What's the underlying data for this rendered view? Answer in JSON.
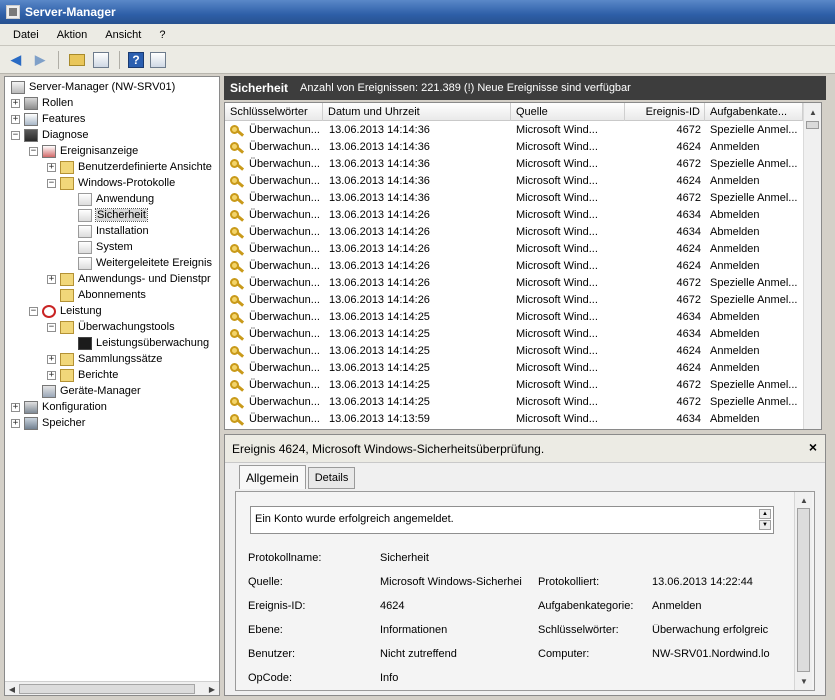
{
  "window": {
    "title": "Server-Manager"
  },
  "menu": [
    "Datei",
    "Aktion",
    "Ansicht",
    "?"
  ],
  "toolbar": {
    "help_label": "?"
  },
  "tree": [
    {
      "label": "Server-Manager (NW-SRV01)",
      "level": 0,
      "exp": "",
      "icon": "server-icon"
    },
    {
      "label": "Rollen",
      "level": 0,
      "exp": "+",
      "icon": "roles-icon"
    },
    {
      "label": "Features",
      "level": 0,
      "exp": "+",
      "icon": "features-icon"
    },
    {
      "label": "Diagnose",
      "level": 0,
      "exp": "-",
      "icon": "diagnostics-icon"
    },
    {
      "label": "Ereignisanzeige",
      "level": 1,
      "exp": "-",
      "icon": "event-viewer-icon"
    },
    {
      "label": "Benutzerdefinierte Ansichte",
      "level": 2,
      "exp": "+",
      "icon": "folder-icon"
    },
    {
      "label": "Windows-Protokolle",
      "level": 2,
      "exp": "-",
      "icon": "folder-icon"
    },
    {
      "label": "Anwendung",
      "level": 3,
      "exp": "",
      "icon": "log-icon"
    },
    {
      "label": "Sicherheit",
      "level": 3,
      "exp": "",
      "icon": "log-icon",
      "selected": true
    },
    {
      "label": "Installation",
      "level": 3,
      "exp": "",
      "icon": "log-icon"
    },
    {
      "label": "System",
      "level": 3,
      "exp": "",
      "icon": "log-icon"
    },
    {
      "label": "Weitergeleitete Ereignis",
      "level": 3,
      "exp": "",
      "icon": "log-icon"
    },
    {
      "label": "Anwendungs- und Dienstpr",
      "level": 2,
      "exp": "+",
      "icon": "folder-icon"
    },
    {
      "label": "Abonnements",
      "level": 2,
      "exp": "",
      "icon": "subscriptions-icon"
    },
    {
      "label": "Leistung",
      "level": 1,
      "exp": "-",
      "icon": "performance-icon"
    },
    {
      "label": "Überwachungstools",
      "level": 2,
      "exp": "-",
      "icon": "monitoring-folder-icon"
    },
    {
      "label": "Leistungsüberwachung",
      "level": 3,
      "exp": "",
      "icon": "chart-icon"
    },
    {
      "label": "Sammlungssätze",
      "level": 2,
      "exp": "+",
      "icon": "folder-icon"
    },
    {
      "label": "Berichte",
      "level": 2,
      "exp": "+",
      "icon": "reports-icon"
    },
    {
      "label": "Geräte-Manager",
      "level": 1,
      "exp": "",
      "icon": "device-manager-icon"
    },
    {
      "label": "Konfiguration",
      "level": 0,
      "exp": "+",
      "icon": "configuration-icon"
    },
    {
      "label": "Speicher",
      "level": 0,
      "exp": "+",
      "icon": "storage-icon"
    }
  ],
  "pane": {
    "name": "Sicherheit",
    "status": "Anzahl von Ereignissen: 221.389 (!) Neue Ereignisse sind verfügbar"
  },
  "list": {
    "columns": [
      "Schlüsselwörter",
      "Datum und Uhrzeit",
      "Quelle",
      "Ereignis-ID",
      "Aufgabenkate..."
    ],
    "rows": [
      [
        "Überwachun...",
        "13.06.2013 14:14:36",
        "Microsoft Wind...",
        "4672",
        "Spezielle Anmel..."
      ],
      [
        "Überwachun...",
        "13.06.2013 14:14:36",
        "Microsoft Wind...",
        "4624",
        "Anmelden"
      ],
      [
        "Überwachun...",
        "13.06.2013 14:14:36",
        "Microsoft Wind...",
        "4672",
        "Spezielle Anmel..."
      ],
      [
        "Überwachun...",
        "13.06.2013 14:14:36",
        "Microsoft Wind...",
        "4624",
        "Anmelden"
      ],
      [
        "Überwachun...",
        "13.06.2013 14:14:36",
        "Microsoft Wind...",
        "4672",
        "Spezielle Anmel..."
      ],
      [
        "Überwachun...",
        "13.06.2013 14:14:26",
        "Microsoft Wind...",
        "4634",
        "Abmelden"
      ],
      [
        "Überwachun...",
        "13.06.2013 14:14:26",
        "Microsoft Wind...",
        "4634",
        "Abmelden"
      ],
      [
        "Überwachun...",
        "13.06.2013 14:14:26",
        "Microsoft Wind...",
        "4624",
        "Anmelden"
      ],
      [
        "Überwachun...",
        "13.06.2013 14:14:26",
        "Microsoft Wind...",
        "4624",
        "Anmelden"
      ],
      [
        "Überwachun...",
        "13.06.2013 14:14:26",
        "Microsoft Wind...",
        "4672",
        "Spezielle Anmel..."
      ],
      [
        "Überwachun...",
        "13.06.2013 14:14:26",
        "Microsoft Wind...",
        "4672",
        "Spezielle Anmel..."
      ],
      [
        "Überwachun...",
        "13.06.2013 14:14:25",
        "Microsoft Wind...",
        "4634",
        "Abmelden"
      ],
      [
        "Überwachun...",
        "13.06.2013 14:14:25",
        "Microsoft Wind...",
        "4634",
        "Abmelden"
      ],
      [
        "Überwachun...",
        "13.06.2013 14:14:25",
        "Microsoft Wind...",
        "4624",
        "Anmelden"
      ],
      [
        "Überwachun...",
        "13.06.2013 14:14:25",
        "Microsoft Wind...",
        "4624",
        "Anmelden"
      ],
      [
        "Überwachun...",
        "13.06.2013 14:14:25",
        "Microsoft Wind...",
        "4672",
        "Spezielle Anmel..."
      ],
      [
        "Überwachun...",
        "13.06.2013 14:14:25",
        "Microsoft Wind...",
        "4672",
        "Spezielle Anmel..."
      ],
      [
        "Überwachun...",
        "13.06.2013 14:13:59",
        "Microsoft Wind...",
        "4634",
        "Abmelden"
      ]
    ]
  },
  "detail": {
    "title": "Ereignis 4624, Microsoft Windows-Sicherheitsüberprüfung.",
    "close": "×",
    "tabs": [
      "Allgemein",
      "Details"
    ],
    "message": "Ein Konto wurde erfolgreich angemeldet.",
    "fields": {
      "protokollname_label": "Protokollname:",
      "protokollname": "Sicherheit",
      "quelle_label": "Quelle:",
      "quelle": "Microsoft Windows-Sicherhei",
      "protokolliert_label": "Protokolliert:",
      "protokolliert": "13.06.2013 14:22:44",
      "ereignis_id_label": "Ereignis-ID:",
      "ereignis_id": "4624",
      "aufgabenkategorie_label": "Aufgabenkategorie:",
      "aufgabenkategorie": "Anmelden",
      "ebene_label": "Ebene:",
      "ebene": "Informationen",
      "schluesselwoerter_label": "Schlüsselwörter:",
      "schluesselwoerter": "Überwachung erfolgreic",
      "benutzer_label": "Benutzer:",
      "benutzer": "Nicht zutreffend",
      "computer_label": "Computer:",
      "computer": "NW-SRV01.Nordwind.lo",
      "opcode_label": "OpCode:",
      "opcode": "Info"
    }
  }
}
